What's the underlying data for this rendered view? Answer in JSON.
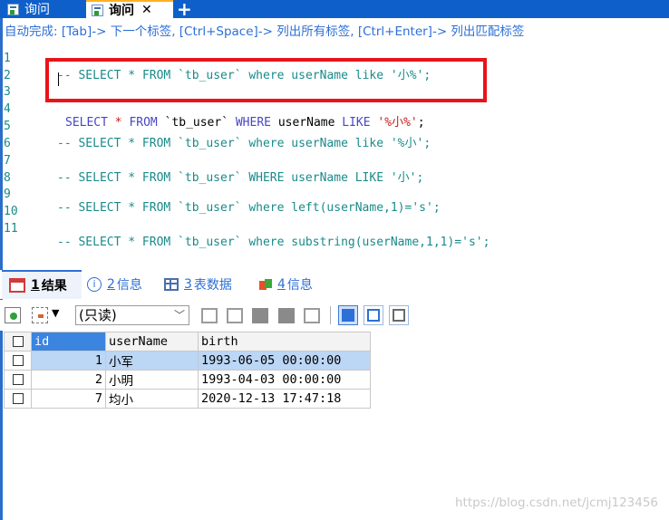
{
  "tabs": {
    "query1": "询问",
    "query2": "询问",
    "new_tab": "+"
  },
  "hint": "自动完成: [Tab]-> 下一个标签, [Ctrl+Space]-> 列出所有标签, [Ctrl+Enter]-> 列出匹配标签",
  "editor": {
    "lines": [
      {
        "num": "1",
        "prefix": "-- ",
        "kw1": "SELECT",
        "mid1": " * ",
        "kw2": "FROM",
        "mid2": " `tb_user` ",
        "kw3": "where",
        "mid3": " userName ",
        "kw4": "like",
        "tail": " '小%';"
      },
      {
        "num": "2"
      },
      {
        "num": "3",
        "kw1": "SELECT",
        "star": " * ",
        "kw2": "FROM",
        "mid2": " `tb_user` ",
        "kw3": "WHERE",
        "mid3": " userName ",
        "kw4": "LIKE",
        "str": " '%小%'",
        "semi": ";"
      },
      {
        "num": "4"
      },
      {
        "num": "5",
        "text": "-- SELECT * FROM `tb_user` where userName like '%小';"
      },
      {
        "num": "6"
      },
      {
        "num": "7",
        "text": "-- SELECT * FROM `tb_user` WHERE userName LIKE '小';"
      },
      {
        "num": "8"
      },
      {
        "num": "9",
        "text": "-- SELECT * FROM `tb_user` where left(userName,1)='s';"
      },
      {
        "num": "10"
      },
      {
        "num": "11",
        "text": "-- SELECT * FROM `tb_user` where substring(userName,1,1)='s';"
      }
    ]
  },
  "result_tabs": [
    {
      "num": "1",
      "label": "结果"
    },
    {
      "num": "2",
      "label": "信息"
    },
    {
      "num": "3",
      "label": "表数据"
    },
    {
      "num": "4",
      "label": "信息"
    }
  ],
  "toolbar": {
    "mode": "(只读)"
  },
  "grid": {
    "columns": [
      "id",
      "userName",
      "birth"
    ],
    "rows": [
      {
        "id": "1",
        "userName": "小军",
        "birth": "1993-06-05 00:00:00"
      },
      {
        "id": "2",
        "userName": "小明",
        "birth": "1993-04-03 00:00:00"
      },
      {
        "id": "7",
        "userName": "均小",
        "birth": "2020-12-13 17:47:18"
      }
    ]
  },
  "watermark": "https://blog.csdn.net/jcmj123456",
  "colors": {
    "tabbar": "#0f5fcb",
    "highlight_border": "#e8141a",
    "comment": "#1a8a8a",
    "keyword": "#4646c8",
    "string": "#c81e1e",
    "selected_row": "#bcd6f5",
    "selected_header": "#3b84e0"
  }
}
